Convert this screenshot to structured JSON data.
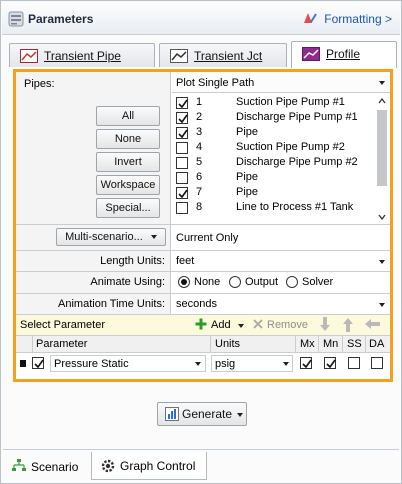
{
  "header": {
    "title": "Parameters",
    "formatting": "Formatting >"
  },
  "tabs": [
    {
      "label": "Transient Pipe"
    },
    {
      "label": "Transient Jct"
    },
    {
      "label": "Profile"
    }
  ],
  "pipes": {
    "label": "Pipes:",
    "selection": "Plot Single Path",
    "buttons": [
      "All",
      "None",
      "Invert",
      "Workspace",
      "Special..."
    ],
    "items": [
      {
        "num": "1",
        "name": "Suction Pipe Pump #1",
        "checked": true
      },
      {
        "num": "2",
        "name": "Discharge Pipe Pump #1",
        "checked": true
      },
      {
        "num": "3",
        "name": "Pipe",
        "checked": true
      },
      {
        "num": "4",
        "name": "Suction Pipe Pump #2",
        "checked": false
      },
      {
        "num": "5",
        "name": "Discharge Pipe Pump #2",
        "checked": false
      },
      {
        "num": "6",
        "name": "Pipe",
        "checked": false
      },
      {
        "num": "7",
        "name": "Pipe",
        "checked": true
      },
      {
        "num": "8",
        "name": "Line to Process #1 Tank",
        "checked": false
      }
    ]
  },
  "scenario": {
    "button": "Multi-scenario...",
    "value": "Current Only"
  },
  "length_units": {
    "label": "Length Units:",
    "value": "feet"
  },
  "animate": {
    "label": "Animate Using:",
    "options": [
      "None",
      "Output",
      "Solver"
    ],
    "selected": "None"
  },
  "animation_time_units": {
    "label": "Animation Time Units:",
    "value": "seconds"
  },
  "param_toolbar": {
    "label": "Select Parameter",
    "add": "Add",
    "remove": "Remove"
  },
  "param_grid": {
    "headers": [
      "Parameter",
      "Units",
      "Mx",
      "Mn",
      "SS",
      "DA"
    ],
    "rows": [
      {
        "parameter": "Pressure Static",
        "units": "psig",
        "mx": true,
        "mn": true,
        "ss": false,
        "da": false
      }
    ]
  },
  "generate": {
    "label": "Generate"
  },
  "bottom_tabs": [
    {
      "label": "Scenario"
    },
    {
      "label": "Graph Control"
    }
  ],
  "colors": {
    "highlight": "#f2a21d",
    "link": "#1a57a8",
    "profile_icon": "#8e2c8e",
    "add_green": "#2a9d2a"
  }
}
